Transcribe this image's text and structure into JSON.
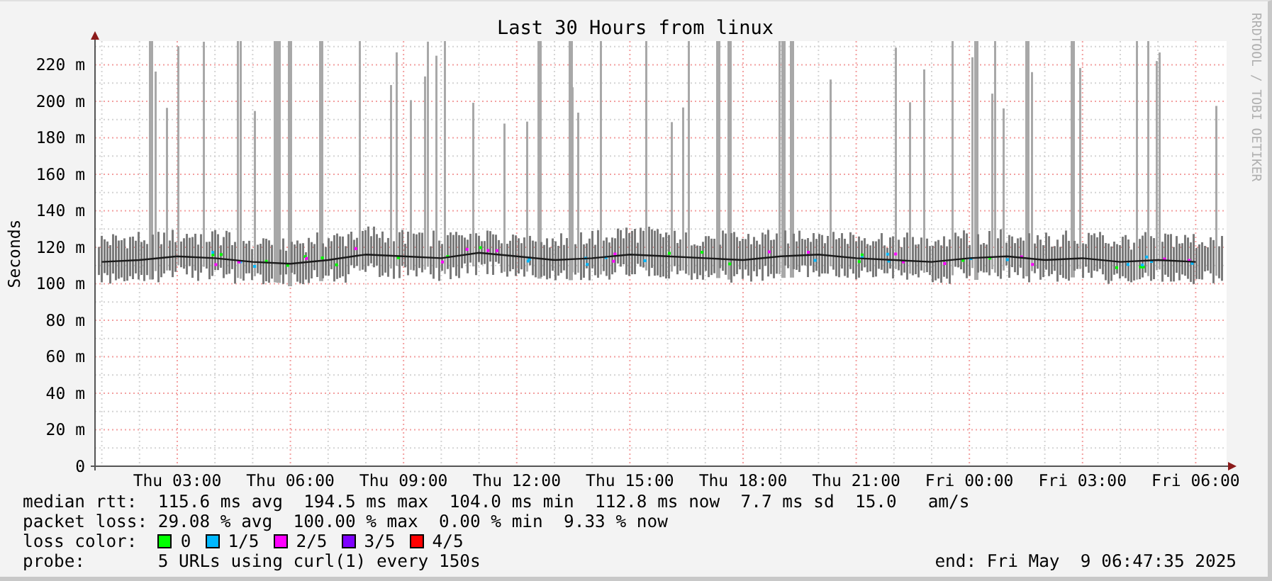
{
  "chart": {
    "chart_data": {
      "type": "line",
      "title": "Last 30 Hours from linux",
      "ylabel": "Seconds",
      "categories": [
        null,
        null,
        "Thu 03:00",
        null,
        null,
        "Thu 06:00",
        null,
        null,
        "Thu 09:00",
        null,
        null,
        "Thu 12:00",
        null,
        null,
        "Thu 15:00",
        null,
        null,
        "Thu 18:00",
        null,
        null,
        "Thu 21:00",
        null,
        null,
        "Fri 00:00",
        null,
        null,
        "Fri 03:00",
        null,
        null,
        "Fri 06:00"
      ],
      "ylim": [
        0,
        233
      ],
      "grid": true,
      "yticks": [
        {
          "value": 0,
          "label": "0"
        },
        {
          "value": 20,
          "label": "20 m"
        },
        {
          "value": 40,
          "label": "40 m"
        },
        {
          "value": 60,
          "label": "60 m"
        },
        {
          "value": 80,
          "label": "80 m"
        },
        {
          "value": 100,
          "label": "100 m"
        },
        {
          "value": 120,
          "label": "120 m"
        },
        {
          "value": 140,
          "label": "140 m"
        },
        {
          "value": 160,
          "label": "160 m"
        },
        {
          "value": 180,
          "label": "180 m"
        },
        {
          "value": 200,
          "label": "200 m"
        },
        {
          "value": 220,
          "label": "220 m"
        }
      ],
      "series": [
        {
          "name": "median rtt:",
          "color": "#1a1a1a",
          "values": [
            112,
            113,
            115,
            114,
            112,
            111,
            113,
            116,
            115,
            114,
            117,
            115,
            113,
            114,
            116,
            115,
            114,
            113,
            115,
            116,
            114,
            113,
            112,
            114,
            115,
            113,
            114,
            112,
            113,
            112
          ]
        }
      ]
    }
  },
  "credit": "RRDTOOL / TOBI OETIKER",
  "legend": {
    "median_rtt": {
      "text": "115.6 ms avg  194.5 ms max  104.0 ms min  112.8 ms now  7.7 ms sd  15.0   am/s"
    },
    "packet_loss": {
      "label": "packet loss:",
      "text": "29.08 % avg  100.00 % max  0.00 % min  9.33 % now"
    },
    "loss_color": {
      "label": "loss color:",
      "items": [
        {
          "label": "0",
          "color": "#00ff00"
        },
        {
          "label": "1/5",
          "color": "#00b8ff"
        },
        {
          "label": "2/5",
          "color": "#ff00ff"
        },
        {
          "label": "3/5",
          "color": "#7e00ff"
        },
        {
          "label": "4/5",
          "color": "#ff0000"
        }
      ]
    },
    "probe": {
      "label": "probe:",
      "text": "5 URLs using curl(1) every 150s",
      "end": "end: Fri May  9 06:47:35 2025"
    }
  }
}
